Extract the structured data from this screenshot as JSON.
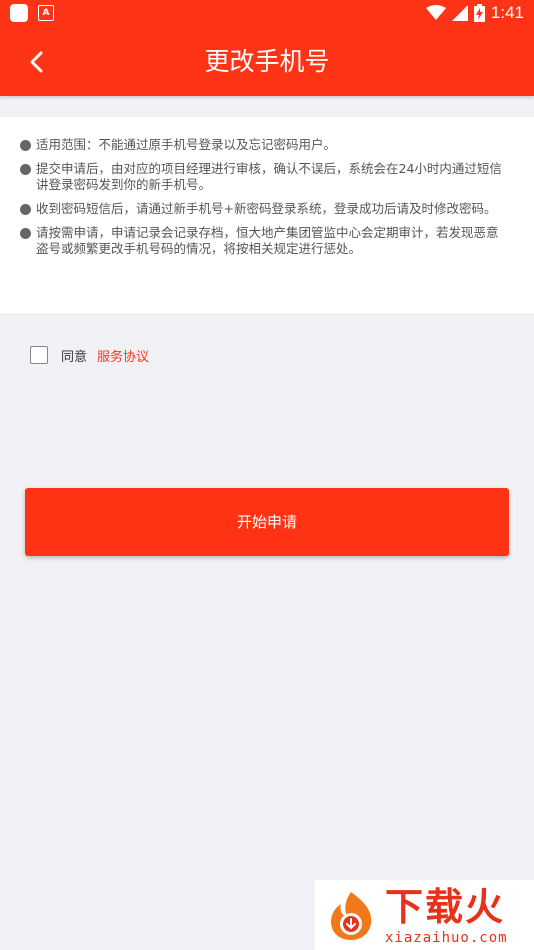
{
  "status_bar": {
    "time": "1:41",
    "notification_letter": "A",
    "icons": [
      "app-icon",
      "notification-icon",
      "wifi-icon",
      "signal-icon",
      "battery-charging-icon"
    ]
  },
  "header": {
    "title": "更改手机号",
    "back_icon": "chevron-left-icon"
  },
  "notices": [
    {
      "text": "适用范围：不能通过原手机号登录以及忘记密码用户。"
    },
    {
      "text": "提交申请后，由对应的项目经理进行审核，确认不误后，系统会在24小时内通过短信讲登录密码发到你的新手机号。"
    },
    {
      "text": "收到密码短信后，请通过新手机号+新密码登录系统，登录成功后请及时修改密码。"
    },
    {
      "text": "请按需申请，申请记录会记录存档，恒大地产集团管监中心会定期审计，若发现恶意盗号或频繁更改手机号码的情况，将按相关规定进行惩处。"
    }
  ],
  "agreement": {
    "label": "同意",
    "link": "服务协议",
    "checked": false
  },
  "apply_button": {
    "label": "开始申请"
  },
  "watermark": {
    "title": "下载火",
    "subtitle": "xiazaihuo.com"
  },
  "colors": {
    "brand": "#ff3417",
    "background": "#f2f2f6",
    "text": "#555555"
  }
}
